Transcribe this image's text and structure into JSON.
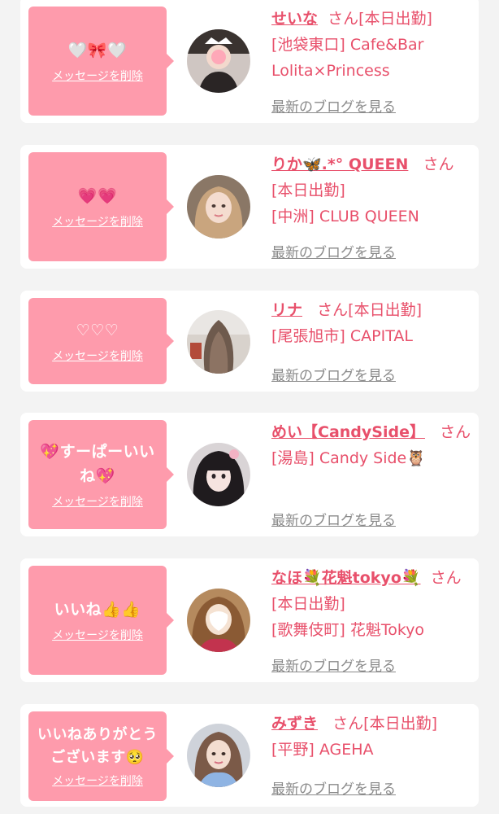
{
  "delete_label": "メッセージを削除",
  "blog_label": "最新のブログを見る",
  "colors": {
    "bubble": "#fe9bac",
    "accent": "#e8506b",
    "link_gray": "#8a8a8a",
    "background": "#f3f3f3"
  },
  "cards": [
    {
      "message": "🤍🎀🤍",
      "name": "せいな",
      "san": "さん",
      "status": "[本日出勤]",
      "shop": "[池袋東口] Cafe&Bar Lolita×Princess"
    },
    {
      "message": "💗💗",
      "name": "りか🦋.*° QUEEN",
      "san": "さん",
      "status": "[本日出勤]",
      "shop": "[中洲] CLUB QUEEN"
    },
    {
      "message": "♡♡♡",
      "name": "リナ",
      "san": "さん",
      "status": "[本日出勤]",
      "shop": "[尾張旭市] CAPITAL"
    },
    {
      "message": "💖すーぱーいいね💖",
      "name": "めい【CandySide】",
      "san": "さん",
      "status": "",
      "shop": "[湯島] Candy Side🦉"
    },
    {
      "message": "いいね👍👍",
      "name": "なほ💐花魁tokyo💐",
      "san": "さん",
      "status": "[本日出勤]",
      "shop": "[歌舞伎町] 花魁Tokyo"
    },
    {
      "message": "いいねありがとうございます🥺",
      "name": "みずき",
      "san": "さん",
      "status": "[本日出勤]",
      "shop": "[平野] AGEHA"
    }
  ]
}
